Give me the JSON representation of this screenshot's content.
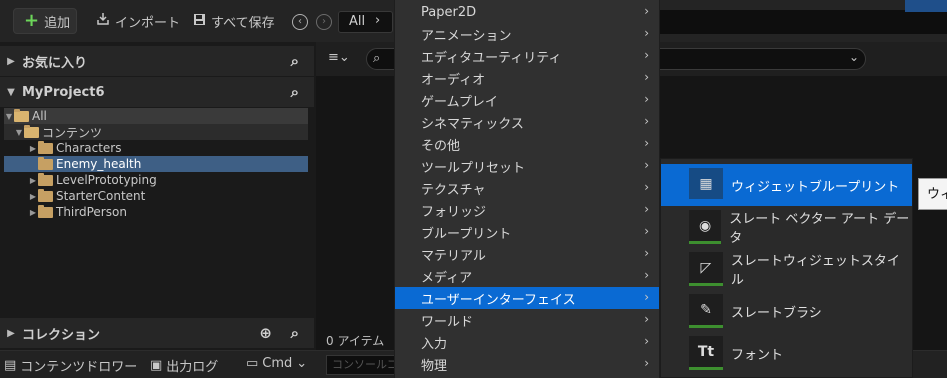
{
  "toolbar": {
    "add_label": "追加",
    "import_label": "インポート",
    "saveall_label": "すべて保存",
    "path_label": "All"
  },
  "left": {
    "favorites_label": "お気に入り",
    "project_label": "MyProject6",
    "tree": [
      {
        "label": "All"
      },
      {
        "label": "コンテンツ"
      },
      {
        "label": "Characters"
      },
      {
        "label": "Enemy_health"
      },
      {
        "label": "LevelPrototyping"
      },
      {
        "label": "StarterContent"
      },
      {
        "label": "ThirdPerson"
      }
    ],
    "collections_label": "コレクション"
  },
  "center": {
    "items_count": "0 アイテム"
  },
  "bottom": {
    "drawer_label": "コンテンツドロワー",
    "log_label": "出力ログ",
    "cmd_label": "Cmd",
    "console_placeholder": "コンソールコ"
  },
  "menu": {
    "items": [
      {
        "label": "Paper2D"
      },
      {
        "label": "アニメーション"
      },
      {
        "label": "エディタユーティリティ"
      },
      {
        "label": "オーディオ"
      },
      {
        "label": "ゲームプレイ"
      },
      {
        "label": "シネマティックス"
      },
      {
        "label": "その他"
      },
      {
        "label": "ツールプリセット"
      },
      {
        "label": "テクスチャ"
      },
      {
        "label": "フォリッジ"
      },
      {
        "label": "ブループリント"
      },
      {
        "label": "マテリアル"
      },
      {
        "label": "メディア"
      },
      {
        "label": "ユーザーインターフェイス"
      },
      {
        "label": "ワールド"
      },
      {
        "label": "入力"
      },
      {
        "label": "物理"
      }
    ],
    "active_index": 13
  },
  "submenu": {
    "items": [
      {
        "label": "ウィジェットブループリント",
        "icon": "widget-blueprint-icon"
      },
      {
        "label": "スレート ベクター アート データ",
        "icon": "slate-vector-art-icon"
      },
      {
        "label": "スレートウィジェットスタイル",
        "icon": "slate-widget-style-icon"
      },
      {
        "label": "スレートブラシ",
        "icon": "slate-brush-icon"
      },
      {
        "label": "フォント",
        "icon": "font-icon"
      }
    ],
    "active_index": 0
  },
  "tooltip": {
    "text": "ウィ"
  }
}
